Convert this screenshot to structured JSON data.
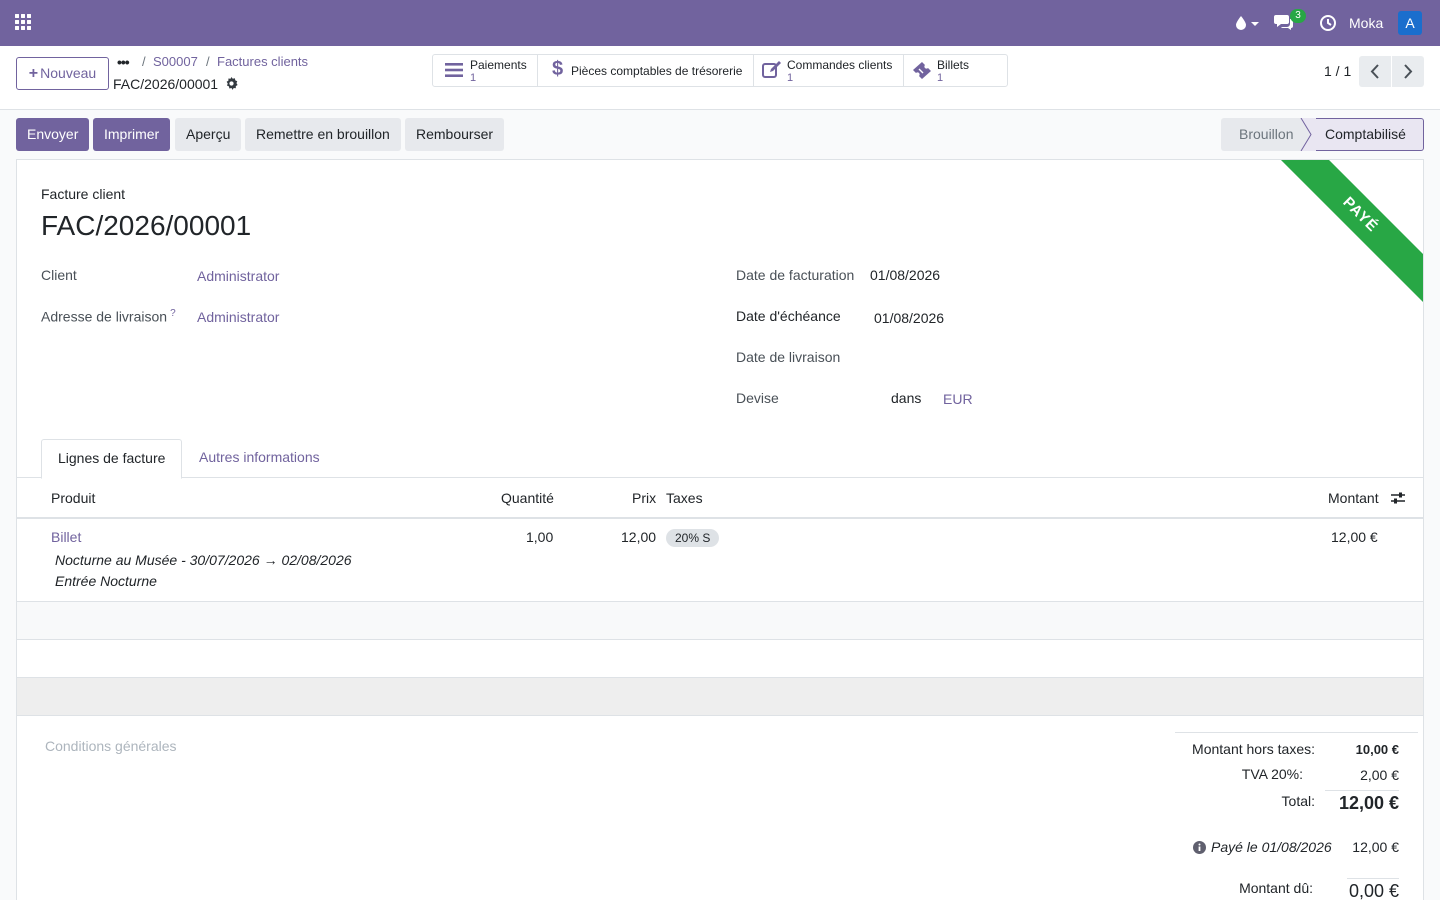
{
  "navbar": {
    "apps_icon": "apps-grid-icon",
    "chat_count": "3",
    "company": "Moka",
    "user_initial": "A",
    "brand_color": "#71639e"
  },
  "control_panel": {
    "new_button": "Nouveau",
    "breadcrumb": {
      "more": "•••",
      "items": [
        "S00007",
        "Factures clients"
      ],
      "separator": "/",
      "current": "FAC/2026/00001"
    },
    "smart_buttons": [
      {
        "label": "Paiements",
        "value": "1",
        "icon": "list-icon"
      },
      {
        "label": "Pièces comptables de trésorerie",
        "value": "",
        "icon": "dollar-icon"
      },
      {
        "label": "Commandes clients",
        "value": "1",
        "icon": "edit-icon"
      },
      {
        "label": "Billets",
        "value": "1",
        "icon": "ticket-icon"
      }
    ],
    "pager": "1 / 1"
  },
  "statusbar": {
    "actions": [
      "Envoyer",
      "Imprimer",
      "Aperçu",
      "Remettre en brouillon",
      "Rembourser"
    ],
    "stages": [
      "Brouillon",
      "Comptabilisé"
    ],
    "active_stage": "Comptabilisé"
  },
  "form": {
    "ribbon": "PAYÉ",
    "ribbon_color": "#28a745",
    "doc_type": "Facture client",
    "doc_number": "FAC/2026/00001",
    "client_label": "Client",
    "client_value": "Administrator",
    "delivery_address_label": "Adresse de livraison",
    "delivery_address_help": "?",
    "delivery_address_value": "Administrator",
    "invoice_date_label": "Date de facturation",
    "invoice_date_value": "01/08/2026",
    "due_date_label": "Date d'échéance",
    "due_date_value": "01/08/2026",
    "delivery_date_label": "Date de livraison",
    "currency_label": "Devise",
    "currency_in": "dans",
    "currency_value": "EUR"
  },
  "tabs": [
    "Lignes de facture",
    "Autres informations"
  ],
  "lines": {
    "headers": [
      "Produit",
      "Quantité",
      "Prix",
      "Taxes",
      "Montant"
    ],
    "rows": [
      {
        "product": "Billet",
        "description_1": "Nocturne au Musée - 30/07/2026 → 02/08/2026",
        "description_2": "Entrée Nocturne",
        "quantity": "1,00",
        "price": "12,00",
        "tax": "20% S",
        "amount": "12,00 €"
      }
    ]
  },
  "terms_placeholder": "Conditions générales",
  "totals": {
    "untaxed_label": "Montant hors taxes:",
    "untaxed_value": "10,00 €",
    "tax_label": "TVA 20%:",
    "tax_value": "2,00 €",
    "total_label": "Total:",
    "total_value": "12,00 €",
    "paid_label": "Payé le 01/08/2026",
    "paid_value": "12,00 €",
    "due_label": "Montant dû:",
    "due_value": "0,00 €"
  }
}
